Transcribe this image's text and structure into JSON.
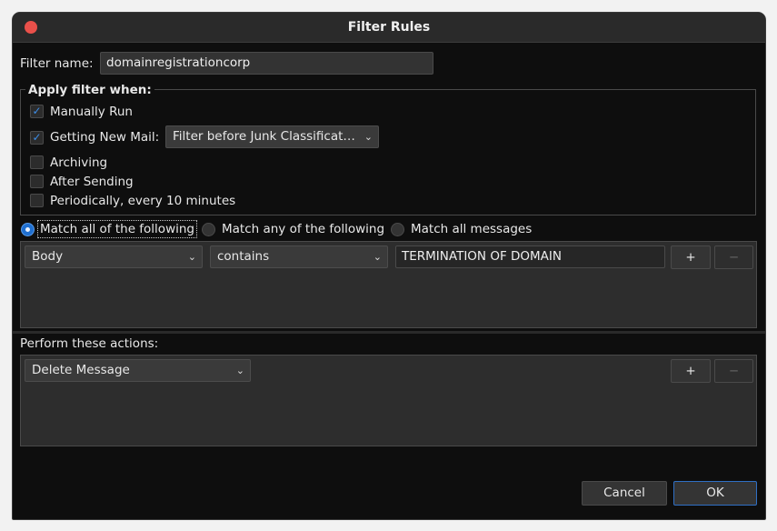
{
  "window": {
    "title": "Filter Rules"
  },
  "filter_name": {
    "label": "Filter name:",
    "value": "domainregistrationcorp"
  },
  "apply_when": {
    "legend": "Apply filter when:",
    "options": [
      {
        "label": "Manually Run",
        "checked": true
      },
      {
        "label": "Getting New Mail:",
        "checked": true
      },
      {
        "label": "Archiving",
        "checked": false
      },
      {
        "label": "After Sending",
        "checked": false
      },
      {
        "label": "Periodically, every 10 minutes",
        "checked": false
      }
    ],
    "new_mail_select": "Filter before Junk Classificat…"
  },
  "match": {
    "options": [
      {
        "label": "Match all of the following",
        "selected": true
      },
      {
        "label": "Match any of the following",
        "selected": false
      },
      {
        "label": "Match all messages",
        "selected": false
      }
    ]
  },
  "conditions": [
    {
      "field": "Body",
      "operator": "contains",
      "value": "TERMINATION OF DOMAIN",
      "add": "+",
      "remove": "−"
    }
  ],
  "actions": {
    "label": "Perform these actions:",
    "rows": [
      {
        "action": "Delete Message",
        "add": "+",
        "remove": "−"
      }
    ]
  },
  "buttons": {
    "cancel": "Cancel",
    "ok": "OK"
  },
  "colors": {
    "accent": "#1f6fd0",
    "close": "#e9504a"
  }
}
